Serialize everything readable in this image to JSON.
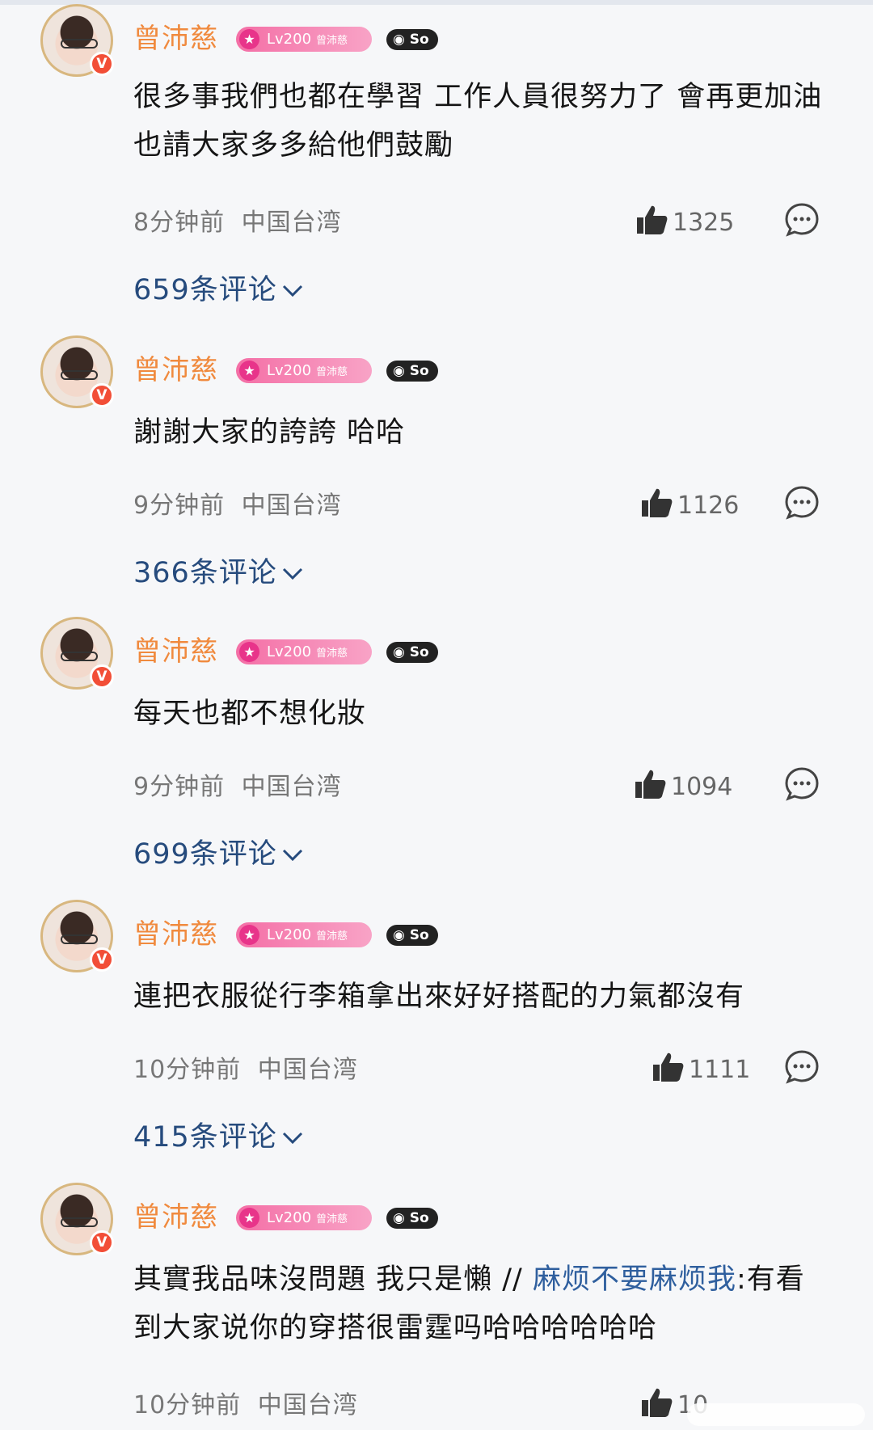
{
  "comments": [
    {
      "user": "曾沛慈",
      "level": "Lv200",
      "level_name": "曾沛慈",
      "badge": "So",
      "text": "很多事我們也都在學習 工作人員很努力了 會再更加油 也請大家多多給他們鼓勵",
      "mention": "",
      "after_mention": "",
      "time": "8分钟前",
      "location": "中国台湾",
      "likes": "1325",
      "replies": "659条评论"
    },
    {
      "user": "曾沛慈",
      "level": "Lv200",
      "level_name": "曾沛慈",
      "badge": "So",
      "text": "謝謝大家的誇誇 哈哈",
      "mention": "",
      "after_mention": "",
      "time": "9分钟前",
      "location": "中国台湾",
      "likes": "1126",
      "replies": "366条评论"
    },
    {
      "user": "曾沛慈",
      "level": "Lv200",
      "level_name": "曾沛慈",
      "badge": "So",
      "text": "每天也都不想化妝",
      "mention": "",
      "after_mention": "",
      "time": "9分钟前",
      "location": "中国台湾",
      "likes": "1094",
      "replies": "699条评论"
    },
    {
      "user": "曾沛慈",
      "level": "Lv200",
      "level_name": "曾沛慈",
      "badge": "So",
      "text": "連把衣服從行李箱拿出來好好搭配的力氣都沒有",
      "mention": "",
      "after_mention": "",
      "time": "10分钟前",
      "location": "中国台湾",
      "likes": "1111",
      "replies": "415条评论"
    },
    {
      "user": "曾沛慈",
      "level": "Lv200",
      "level_name": "曾沛慈",
      "badge": "So",
      "text": "其實我品味沒問題 我只是懶 // ",
      "mention": "麻烦不要麻烦我",
      "after_mention": ":有看到大家说你的穿搭很雷霆吗哈哈哈哈哈哈",
      "time": "10分钟前",
      "location": "中国台湾",
      "likes": "10",
      "replies": ""
    }
  ],
  "colors": {
    "username": "#f08a3e",
    "mention": "#2f5f9e",
    "replies_link": "#264b7d",
    "background": "#f6f7f9"
  },
  "icons": [
    "verified-v-icon",
    "star-icon",
    "thumbs-up-icon",
    "comment-bubble-icon",
    "chevron-down-icon"
  ]
}
